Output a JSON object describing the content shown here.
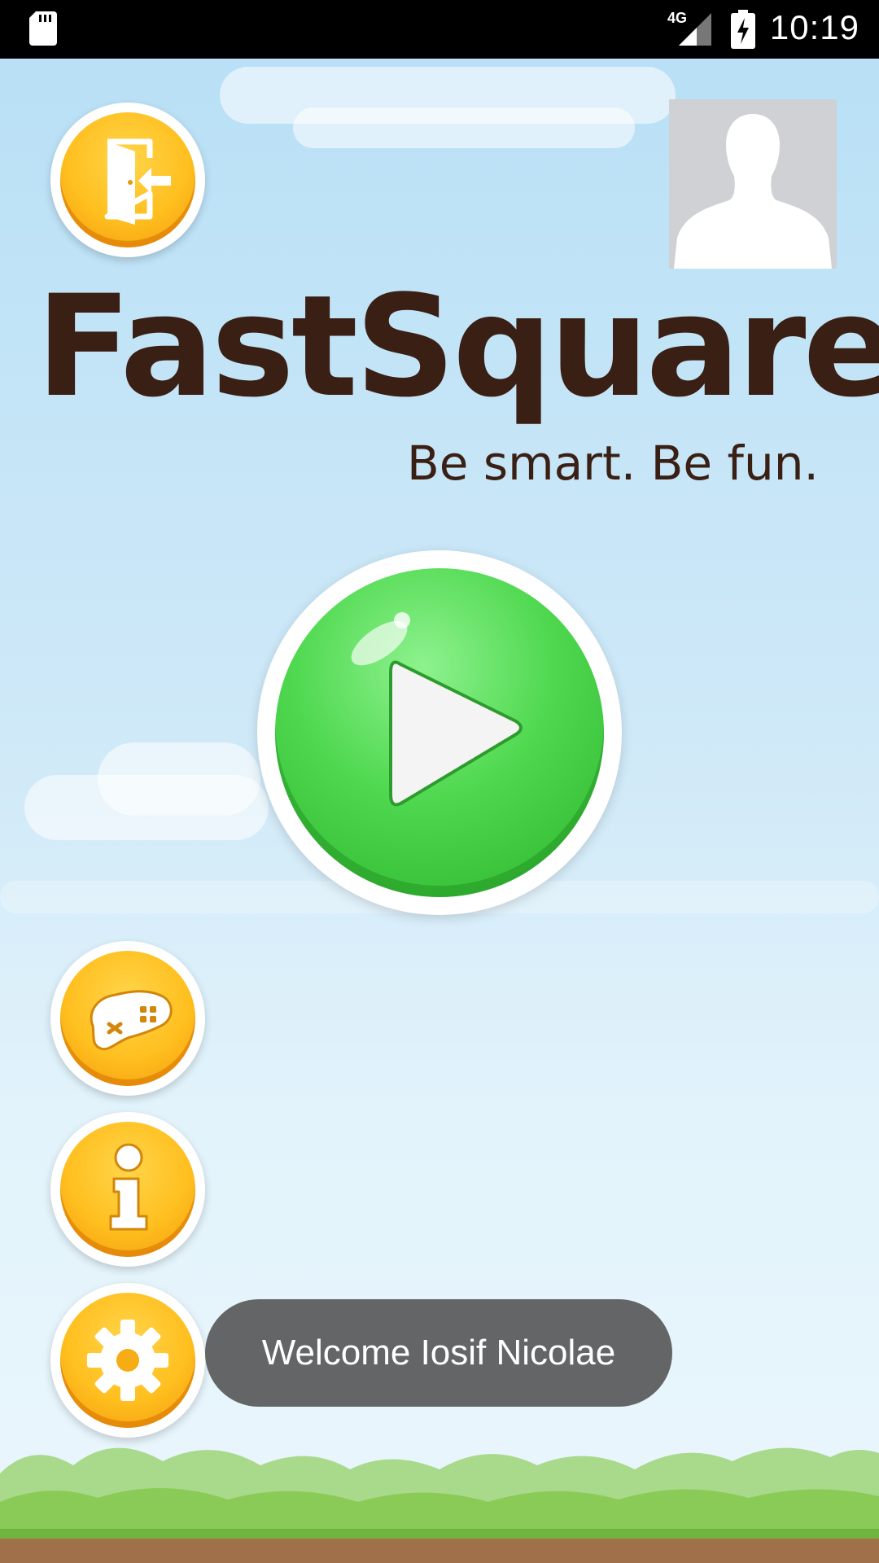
{
  "status_bar": {
    "network": "4G",
    "time": "10:19",
    "icons": [
      "sd-card-icon",
      "signal-4g-icon",
      "battery-charging-icon"
    ]
  },
  "app": {
    "title": "FastSquare",
    "tagline": "Be smart. Be fun."
  },
  "buttons": {
    "exit_icon": "exit-door-icon",
    "play_icon": "play-icon",
    "games_icon": "gamepad-icon",
    "info_icon": "info-icon",
    "settings_icon": "gear-icon"
  },
  "profile": {
    "icon": "user-avatar-icon"
  },
  "toast": {
    "message": "Welcome Iosif Nicolae"
  },
  "colors": {
    "status_bar": "#000000",
    "sky_top": "#b9e0f6",
    "title_text": "#3a1f14",
    "play_green": "#4fd84f",
    "button_orange": "#ffbf1f",
    "toast_bg": "#646566"
  }
}
